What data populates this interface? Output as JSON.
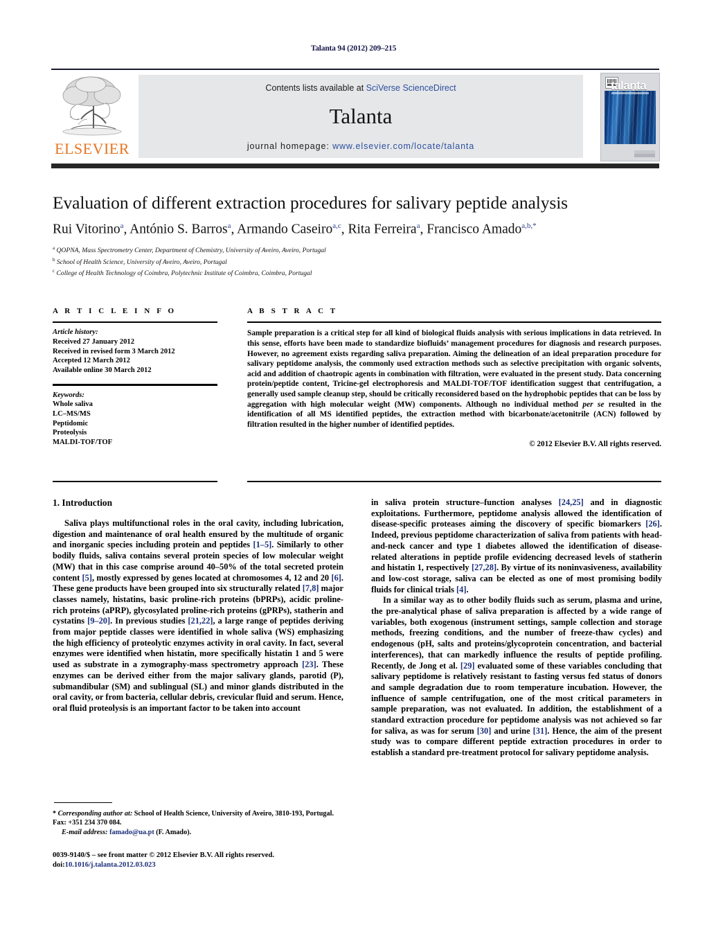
{
  "running_head": "Talanta 94 (2012) 209–215",
  "masthead": {
    "publisher_name": "ELSEVIER",
    "contents_prefix": "Contents lists available at ",
    "contents_link": "SciVerse ScienceDirect",
    "journal_name": "Talanta",
    "homepage_prefix": "journal homepage: ",
    "homepage_url": "www.elsevier.com/locate/talanta",
    "cover_title": "talanta",
    "accent_link_color": "#2a4f9e",
    "publisher_color": "#e87422"
  },
  "article": {
    "title": "Evaluation of different extraction procedures for salivary peptide analysis",
    "authors_html": "Rui Vitorino<sup>a</sup>, António S. Barros<sup>a</sup>, Armando Caseiro<sup>a,c</sup>, Rita Ferreira<sup>a</sup>, Francisco Amado<sup>a,b,</sup><sup>*</sup>",
    "affiliations": [
      {
        "marker": "a",
        "text": "QOPNA, Mass Spectrometry Center, Department of Chemistry, University of Aveiro, Aveiro, Portugal"
      },
      {
        "marker": "b",
        "text": "School of Health Science, University of Aveiro, Aveiro, Portugal"
      },
      {
        "marker": "c",
        "text": "College of Health Technology of Coimbra, Polytechnic Institute of Coimbra, Coimbra, Portugal"
      }
    ]
  },
  "article_info": {
    "heading": "A R T I C L E    I N F O",
    "history_label": "Article history:",
    "history": [
      "Received 27 January 2012",
      "Received in revised form 3 March 2012",
      "Accepted 12 March 2012",
      "Available online 30 March 2012"
    ],
    "keywords_label": "Keywords:",
    "keywords": [
      "Whole saliva",
      "LC–MS/MS",
      "Peptidomic",
      "Proteolysis",
      "MALDI-TOF/TOF"
    ]
  },
  "abstract": {
    "heading": "A B S T R A C T",
    "text_html": "Sample preparation is a critical step for all kind of biological fluids analysis with serious implications in data retrieved. In this sense, efforts have been made to standardize biofluids’ management procedures for diagnosis and research purposes. However, no agreement exists regarding saliva preparation. Aiming the delineation of an ideal preparation procedure for salivary peptidome analysis, the commonly used extraction methods such as selective precipitation with organic solvents, acid and addition of chaotropic agents in combination with filtration, were evaluated in the present study. Data concerning protein/peptide content, Tricine-gel electrophoresis and MALDI-TOF/TOF identification suggest that centrifugation, a generally used sample cleanup step, should be critically reconsidered based on the hydrophobic peptides that can be loss by aggregation with high molecular weight (MW) components. Although no individual method <em>per se</em> resulted in the identification of all MS identified peptides, the extraction method with bicarbonate/acetonitrile (ACN) followed by filtration resulted in the higher number of identified peptides.",
    "copyright": "© 2012 Elsevier B.V. All rights reserved."
  },
  "body": {
    "section_heading": "1.  Introduction",
    "left_paragraphs_html": [
      "Saliva plays multifunctional roles in the oral cavity, including lubrication, digestion and maintenance of oral health ensured by the multitude of organic and inorganic species including protein and peptides <span class=\"ref\">[1–5]</span>. Similarly to other bodily fluids, saliva contains several protein species of low molecular weight (MW) that in this case comprise around 40–50% of the total secreted protein content <span class=\"ref\">[5]</span>, mostly expressed by genes located at chromosomes 4, 12 and 20 <span class=\"ref\">[6]</span>. These gene products have been grouped into six structurally related <span class=\"ref\">[7,8]</span> major classes namely, histatins, basic proline-rich proteins (bPRPs), acidic proline-rich proteins (aPRP), glycosylated proline-rich proteins (gPRPs), statherin and cystatins <span class=\"ref\">[9–20]</span>. In previous studies <span class=\"ref\">[21,22]</span>, a large range of peptides deriving from major peptide classes were identified in whole saliva (WS) emphasizing the high efficiency of proteolytic enzymes activity in oral cavity. In fact, several enzymes were identified when histatin, more specifically histatin 1 and 5 were used as substrate in a zymography-mass spectrometry approach <span class=\"ref\">[23]</span>. These enzymes can be derived either from the major salivary glands, parotid (P), submandibular (SM) and sublingual (SL) and minor glands distributed in the oral cavity, or from bacteria, cellular debris, crevicular fluid and serum. Hence, oral fluid proteolysis is an important factor to be taken into account"
    ],
    "right_paragraphs_html": [
      "in saliva protein structure–function analyses <span class=\"ref\">[24,25]</span> and in diagnostic exploitations. Furthermore, peptidome analysis allowed the identification of disease-specific proteases aiming the discovery of specific biomarkers <span class=\"ref\">[26]</span>. Indeed, previous peptidome characterization of saliva from patients with head-and-neck cancer and type 1 diabetes allowed the identification of disease-related alterations in peptide profile evidencing decreased levels of statherin and histatin 1, respectively <span class=\"ref\">[27,28]</span>. By virtue of its noninvasiveness, availability and low-cost storage, saliva can be elected as one of most promising bodily fluids for clinical trials <span class=\"ref\">[4]</span>.",
      "In a similar way as to other bodily fluids such as serum, plasma and urine, the pre-analytical phase of saliva preparation is affected by a wide range of variables, both exogenous (instrument settings, sample collection and storage methods, freezing conditions, and the number of freeze-thaw cycles) and endogenous (pH, salts and proteins/glycoprotein concentration, and bacterial interferences), that can markedly influence the results of peptide profiling. Recently, de Jong et al. <span class=\"ref\">[29]</span> evaluated some of these variables concluding that salivary peptidome is relatively resistant to fasting versus fed status of donors and sample degradation due to room temperature incubation. However, the influence of sample centrifugation, one of the most critical parameters in sample preparation, was not evaluated. In addition, the establishment of a standard extraction procedure for peptidome analysis was not achieved so far for saliva, as was for serum <span class=\"ref\">[30]</span> and urine <span class=\"ref\">[31]</span>. Hence, the aim of the present study was to compare different peptide extraction procedures in order to establish a standard pre-treatment protocol for salivary peptidome analysis."
    ]
  },
  "footnotes": {
    "corresponding_html": "* <em>Corresponding author at:</em> School of Health Science, University of Aveiro, 3810-193, Portugal. Fax: +351 234 370 084.",
    "email_label": "E-mail address:",
    "email": "famado@ua.pt",
    "email_suffix": "(F. Amado).",
    "issn_line": "0039-9140/$ – see front matter © 2012 Elsevier B.V. All rights reserved.",
    "doi_prefix": "doi:",
    "doi": "10.1016/j.talanta.2012.03.023"
  }
}
